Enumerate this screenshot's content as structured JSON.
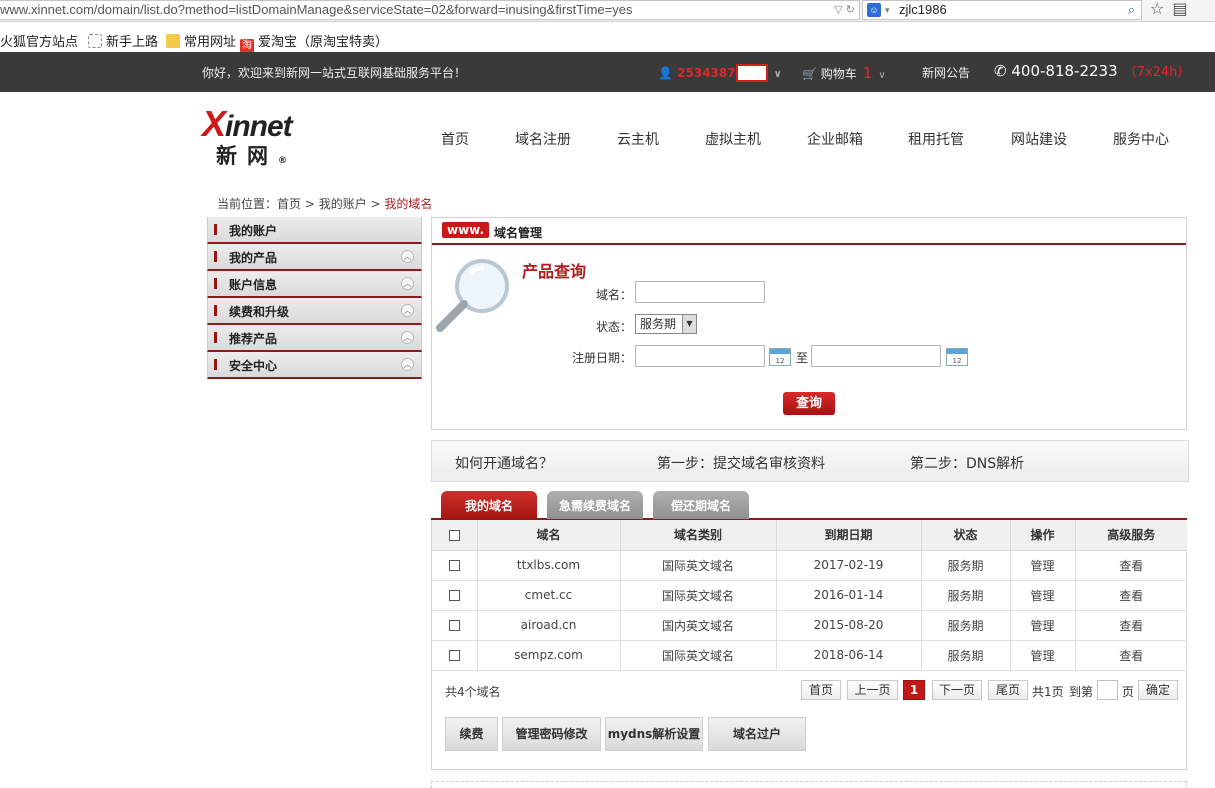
{
  "browser": {
    "url": "www.xinnet.com/domain/list.do?method=listDomainManage&serviceState=02&forward=inusing&firstTime=yes",
    "search_value": "zjlc1986",
    "bookmarks": [
      "火狐官方站点",
      "新手上路",
      "常用网址",
      "爱淘宝（原淘宝特卖）"
    ]
  },
  "topbar": {
    "welcome": "你好，欢迎来到新网一站式互联网基础服务平台！",
    "user_id": "2534387",
    "cart_label": "购物车",
    "cart_count": "1",
    "notice": "新网公告",
    "phone": "400-818-2233",
    "phone_hours": "（7x24h）"
  },
  "logo": {
    "word_x": "X",
    "word_rest": "innet",
    "cn": "新网",
    "reg": "®"
  },
  "nav": [
    "首页",
    "域名注册",
    "云主机",
    "虚拟主机",
    "企业邮箱",
    "租用托管",
    "网站建设",
    "服务中心"
  ],
  "breadcrumb": {
    "prefix": "当前位置：",
    "home": "首页",
    "sep1": " > ",
    "account": "我的账户",
    "sep2": " > ",
    "current": "我的域名"
  },
  "sidebar": [
    "我的账户",
    "我的产品",
    "账户信息",
    "续费和升级",
    "推荐产品",
    "安全中心"
  ],
  "query": {
    "badge": "www.",
    "panel_title": "域名管理",
    "title": "产品查询",
    "domain_label": "域名：",
    "status_label": "状态：",
    "status_value": "服务期",
    "date_label": "注册日期：",
    "to": "至",
    "button": "查询"
  },
  "steps": {
    "question": "如何开通域名？",
    "step1": "第一步：提交域名审核资料",
    "step2": "第二步：DNS解析"
  },
  "tabs": [
    "我的域名",
    "急需续费域名",
    "偿还期域名"
  ],
  "table": {
    "headers": [
      "域名",
      "域名类别",
      "到期日期",
      "状态",
      "操作",
      "高级服务"
    ],
    "rows": [
      [
        "ttxlbs.com",
        "国际英文域名",
        "2017-02-19",
        "服务期",
        "管理",
        "查看"
      ],
      [
        "cmet.cc",
        "国际英文域名",
        "2016-01-14",
        "服务期",
        "管理",
        "查看"
      ],
      [
        "airoad.cn",
        "国内英文域名",
        "2015-08-20",
        "服务期",
        "管理",
        "查看"
      ],
      [
        "sempz.com",
        "国际英文域名",
        "2018-06-14",
        "服务期",
        "管理",
        "查看"
      ]
    ]
  },
  "pagination": {
    "count": "共4个域名",
    "first": "首页",
    "prev": "上一页",
    "current": "1",
    "next": "下一页",
    "last": "尾页",
    "total": "共1页",
    "goto": "到第",
    "page": "页",
    "confirm": "确定"
  },
  "actions": [
    "续费",
    "管理密码修改",
    "mydns解析设置",
    "域名过户"
  ]
}
